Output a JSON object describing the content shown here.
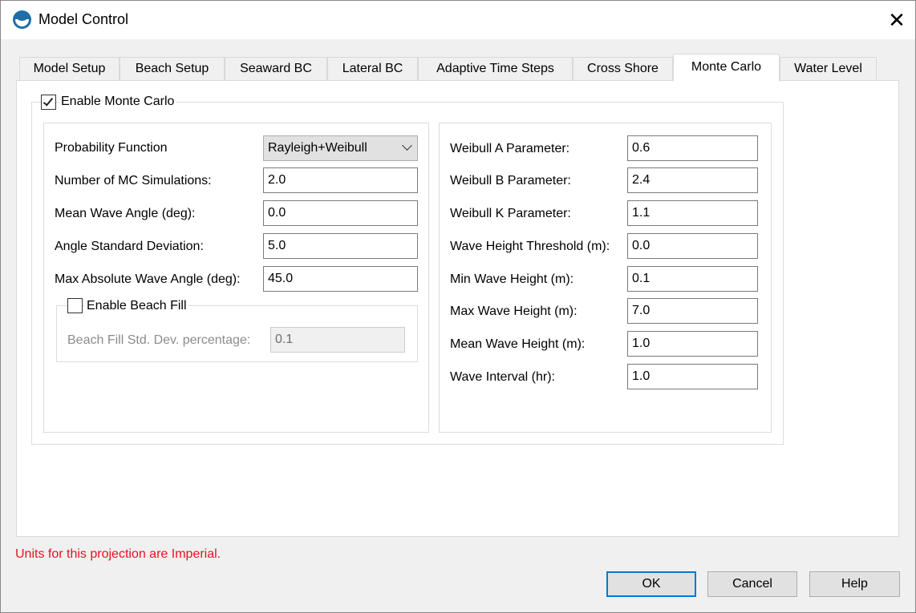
{
  "window": {
    "title": "Model Control",
    "close_label": "✕"
  },
  "tabs": [
    {
      "label": "Model Setup"
    },
    {
      "label": "Beach Setup"
    },
    {
      "label": "Seaward BC"
    },
    {
      "label": "Lateral BC"
    },
    {
      "label": "Adaptive Time Steps"
    },
    {
      "label": "Cross Shore"
    },
    {
      "label": "Monte Carlo",
      "active": true
    },
    {
      "label": "Water Level"
    }
  ],
  "monte_carlo": {
    "enable_label": "Enable Monte Carlo",
    "enable_checked": true,
    "left": {
      "probability_function_label": "Probability Function",
      "probability_function_value": "Rayleigh+Weibull",
      "num_sim_label": "Number of MC Simulations:",
      "num_sim_value": "2.0",
      "mean_angle_label": "Mean Wave Angle (deg):",
      "mean_angle_value": "0.0",
      "angle_std_label": "Angle Standard Deviation:",
      "angle_std_value": "5.0",
      "max_angle_label": "Max Absolute Wave Angle (deg):",
      "max_angle_value": "45.0",
      "beach_fill_label": "Enable Beach Fill",
      "beach_fill_checked": false,
      "beach_fill_std_label": "Beach Fill Std. Dev. percentage:",
      "beach_fill_std_value": "0.1"
    },
    "right": {
      "weibull_a_label": "Weibull A Parameter:",
      "weibull_a_value": "0.6",
      "weibull_b_label": "Weibull B Parameter:",
      "weibull_b_value": "2.4",
      "weibull_k_label": "Weibull K Parameter:",
      "weibull_k_value": "1.1",
      "wave_thresh_label": "Wave Height Threshold (m):",
      "wave_thresh_value": "0.0",
      "min_wave_label": "Min Wave Height (m):",
      "min_wave_value": "0.1",
      "max_wave_label": "Max Wave Height (m):",
      "max_wave_value": "7.0",
      "mean_wave_label": "Mean Wave Height (m):",
      "mean_wave_value": "1.0",
      "wave_interval_label": "Wave Interval (hr):",
      "wave_interval_value": "1.0"
    }
  },
  "footer": {
    "units_note": "Units for this projection are Imperial.",
    "ok_label": "OK",
    "cancel_label": "Cancel",
    "help_label": "Help"
  },
  "colors": {
    "note": "#e81123",
    "accent": "#0078d7"
  }
}
